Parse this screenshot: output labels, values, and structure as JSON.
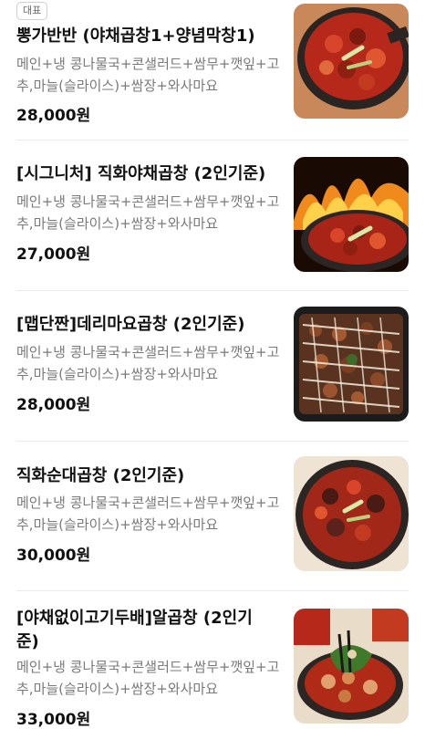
{
  "badge_label": "대표",
  "items": [
    {
      "name": "뽕가반반 (야채곱창1+양념막창1)",
      "desc": "메인+냉 콩나물국+콘샐러드+쌈무+깻잎+고추,마늘(슬라이스)+쌈장+와사마요",
      "price": "28,000원"
    },
    {
      "name": "[시그니처] 직화야채곱창 (2인기준)",
      "desc": "메인+냉 콩나물국+콘샐러드+쌈무+깻잎+고추,마늘(슬라이스)+쌈장+와사마요",
      "price": "27,000원"
    },
    {
      "name": "[맵단짠]데리마요곱창 (2인기준)",
      "desc": "메인+냉 콩나물국+콘샐러드+쌈무+깻잎+고추,마늘(슬라이스)+쌈장+와사마요",
      "price": "28,000원"
    },
    {
      "name": "직화순대곱창 (2인기준)",
      "desc": "메인+냉 콩나물국+콘샐러드+쌈무+깻잎+고추,마늘(슬라이스)+쌈장+와사마요",
      "price": "30,000원"
    },
    {
      "name": "[야채없이고기두배]알곱창 (2인기준)",
      "desc": "메인+냉 콩나물국+콘샐러드+쌈무+깻잎+고추,마늘(슬라이스)+쌈장+와사마요",
      "price": "33,000원"
    }
  ]
}
